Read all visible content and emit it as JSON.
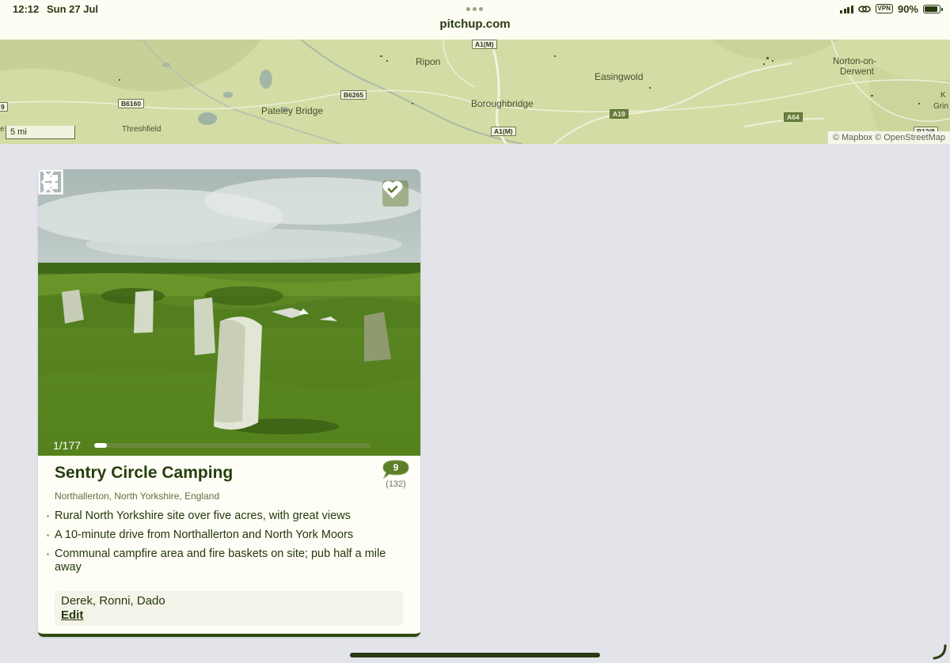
{
  "status_bar": {
    "time": "12:12",
    "date": "Sun 27 Jul",
    "url": "pitchup.com",
    "vpn": "VPN",
    "battery_percent": "90%",
    "battery_level": 0.9,
    "icons": [
      "signal-icon",
      "link-icon",
      "battery-icon"
    ]
  },
  "map": {
    "places": {
      "ripon": "Ripon",
      "easingwold": "Easingwold",
      "norton": "Norton-on-",
      "norton2": "Derwent",
      "pateley": "Pateley Bridge",
      "boroughbridge": "Boroughbridge",
      "threshfield": "Threshfield",
      "edge_k": "K",
      "edge_grin": "Grin",
      "edge_e": "e"
    },
    "roads": {
      "a1m_top": "A1(M)",
      "b6160": "B6160",
      "b6265": "B6265",
      "a1m_bottom": "A1(M)",
      "a19": "A19",
      "a64": "A64",
      "b1248": "B12/8",
      "edge_9": "9"
    },
    "scale": "5 mi",
    "attribution": "© Mapbox © OpenStreetMap"
  },
  "card": {
    "title": "Sentry Circle Camping",
    "location": "Northallerton, North Yorkshire, England",
    "photo_counter": "1/177",
    "photo_progress": 0.006,
    "rating": "9",
    "review_count": "(132)",
    "favourited": true,
    "features": [
      "Rural North Yorkshire site over five acres, with great views",
      "A 10-minute drive from Northallerton and North York Moors",
      "Communal campfire area and fire baskets on site; pub half a mile away"
    ],
    "notes": {
      "names": "Derek, Ronni, Dado",
      "edit_label": "Edit"
    }
  },
  "colors": {
    "brand_dark": "#263d0c",
    "map_land": "#d3dca4",
    "page_bg": "#e2e4ea"
  }
}
